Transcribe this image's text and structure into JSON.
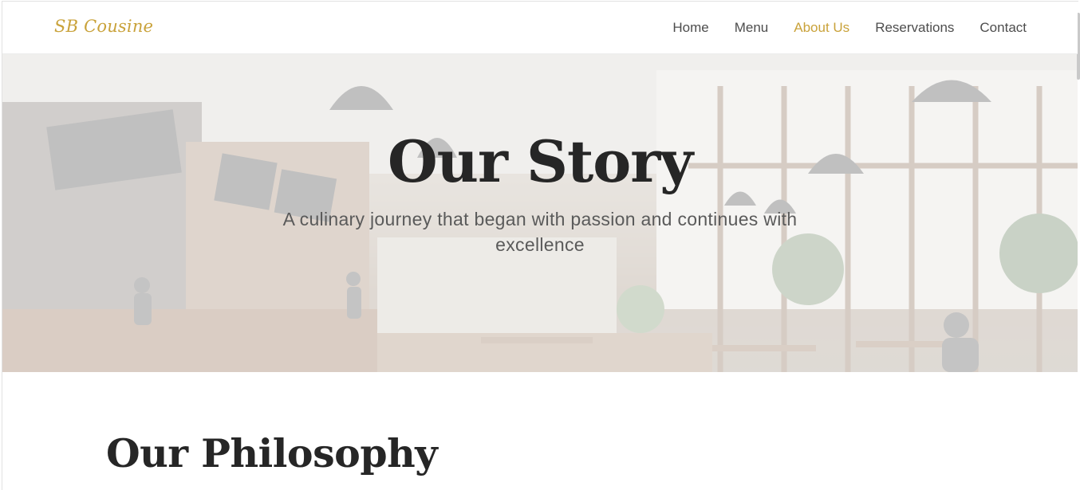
{
  "brand": {
    "logo": "SB Cousine",
    "accent": "#c9a23a"
  },
  "nav": {
    "items": [
      {
        "label": "Home",
        "active": false
      },
      {
        "label": "Menu",
        "active": false
      },
      {
        "label": "About Us",
        "active": true
      },
      {
        "label": "Reservations",
        "active": false
      },
      {
        "label": "Contact",
        "active": false
      }
    ]
  },
  "hero": {
    "title": "Our Story",
    "subtitle": "A culinary journey that began with passion and continues with excellence",
    "background": "cafe-interior-photo"
  },
  "section": {
    "title": "Our Philosophy"
  }
}
